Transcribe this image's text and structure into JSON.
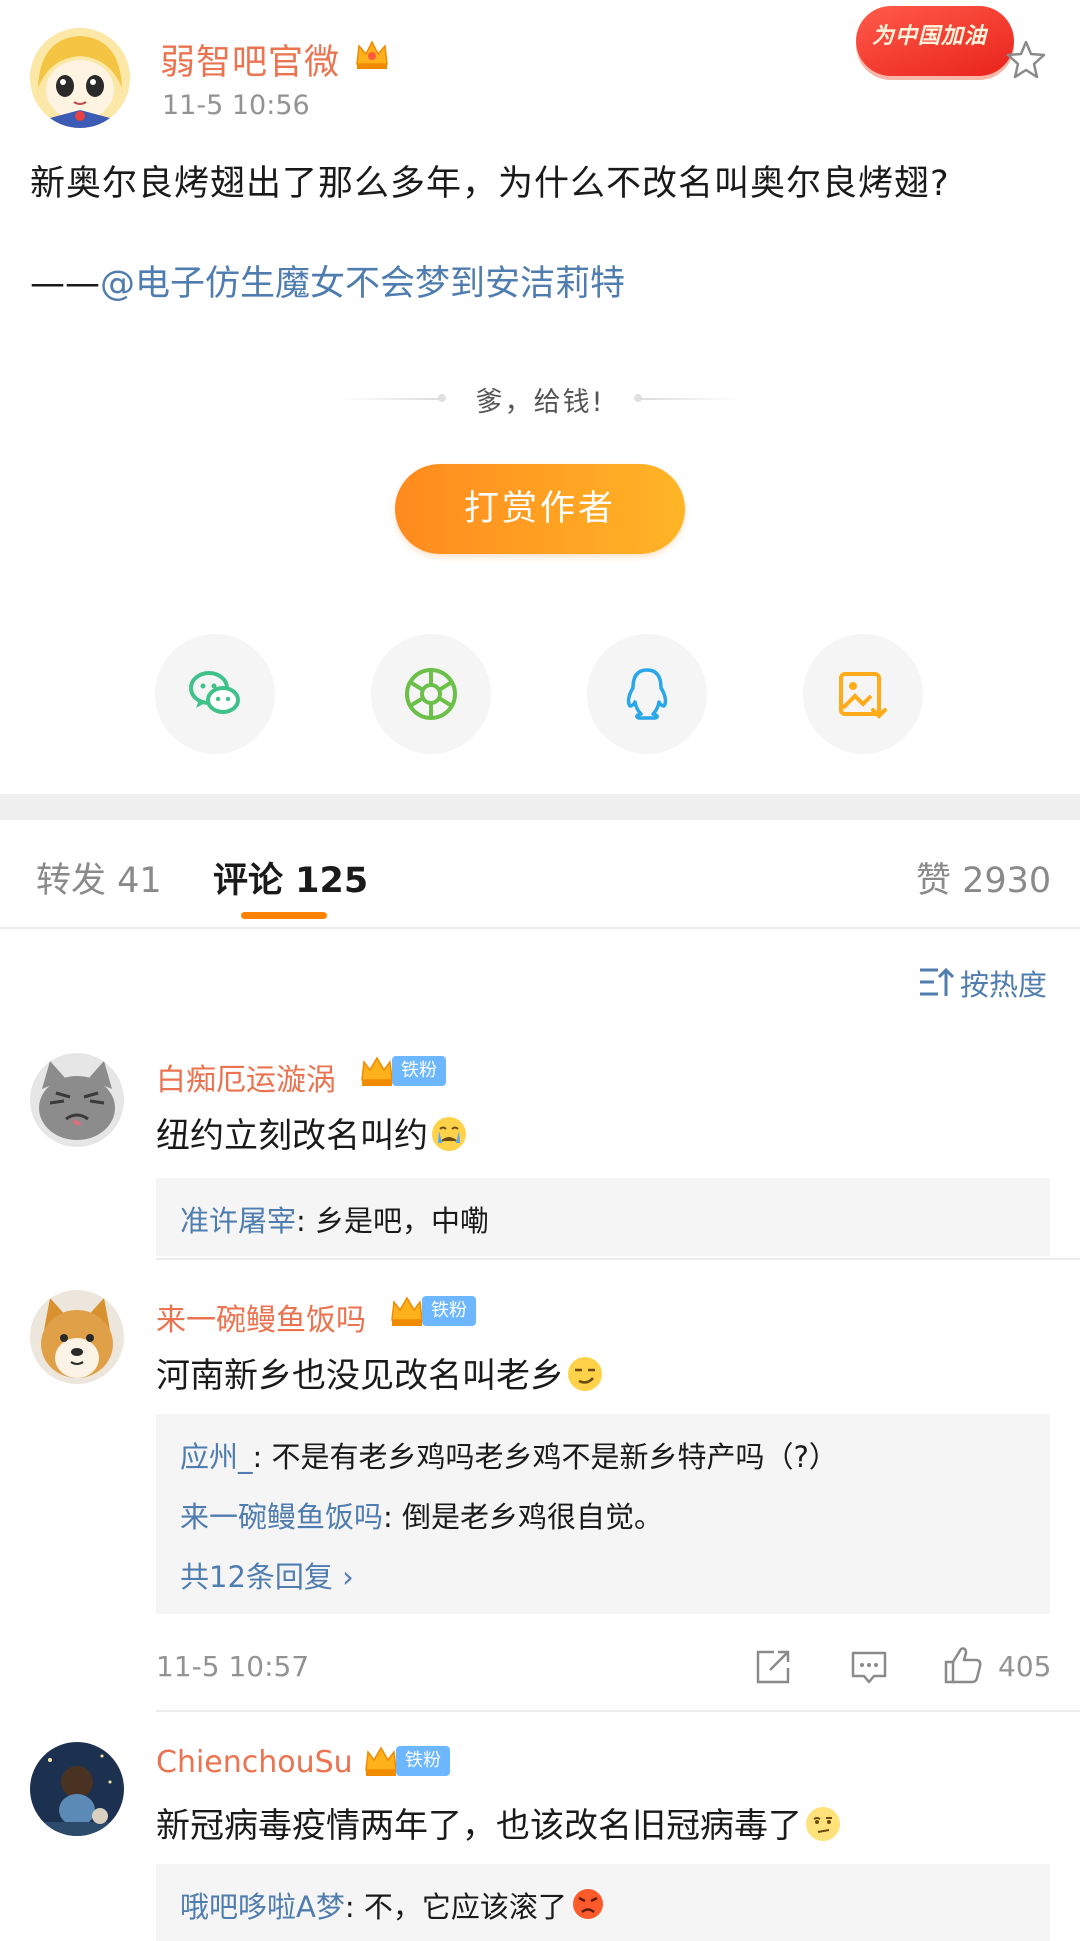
{
  "post": {
    "author": "弱智吧官微",
    "time": "11-5 10:56",
    "promo_badge": "为中国加油",
    "text": "新奥尔良烤翅出了那么多年，为什么不改名叫奥尔良烤翅?",
    "credit_dash": "——",
    "credit_mention": "@电子仿生魔女不会梦到安洁莉特",
    "reward_caption": "爹，给钱!",
    "tip_button": "打赏作者",
    "share_icons": [
      "wechat-icon",
      "moments-icon",
      "qq-icon",
      "save-image-icon"
    ]
  },
  "tabs": {
    "repost": "转发 41",
    "comment": "评论 125",
    "like": "赞 2930"
  },
  "sort": {
    "label": "按热度"
  },
  "comments": [
    {
      "name": "白痴厄运漩涡",
      "badge": "铁粉",
      "text": "纽约立刻改名叫约",
      "emoji": "crying-face-emoji",
      "replies": [
        {
          "user": "准许屠宰",
          "text": ": 乡是吧，中嘞"
        }
      ]
    },
    {
      "name": "来一碗鳗鱼饭吗",
      "badge": "铁粉",
      "text": "河南新乡也没见改名叫老乡",
      "emoji": "smirk-face-emoji",
      "replies": [
        {
          "user": "应州_",
          "text": ": 不是有老乡鸡吗老乡鸡不是新乡特产吗（?）"
        },
        {
          "user": "来一碗鳗鱼饭吗",
          "text": ": 倒是老乡鸡很自觉。"
        }
      ],
      "more": "共12条回复",
      "time": "11-5 10:57",
      "likes": "405"
    },
    {
      "name": "ChienchouSu",
      "badge": "铁粉",
      "text": "新冠病毒疫情两年了，也该改名旧冠病毒了",
      "emoji": "thinking-face-emoji",
      "replies": [
        {
          "user": "哦吧哆啦A梦",
          "text": ": 不，它应该滚了"
        }
      ]
    }
  ],
  "colors": {
    "username": "#eb7350",
    "link": "#507daf",
    "accent": "#ff8200",
    "fan_badge": "#6cb7ff"
  }
}
